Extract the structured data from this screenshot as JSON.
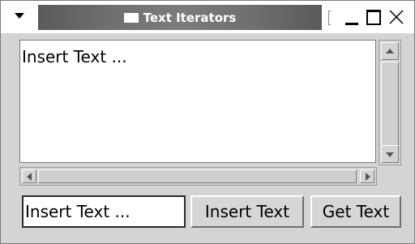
{
  "window": {
    "title": "Text Iterators"
  },
  "titlebar": {
    "menu_icon": "chevron-down-icon",
    "minimize_icon": "minimize-icon",
    "maximize_icon": "maximize-icon",
    "close_icon": "close-icon"
  },
  "text_area": {
    "content": "Insert Text ..."
  },
  "entry": {
    "value": "Insert Text ..."
  },
  "buttons": {
    "insert_text": "Insert Text",
    "get_text": "Get Text"
  }
}
